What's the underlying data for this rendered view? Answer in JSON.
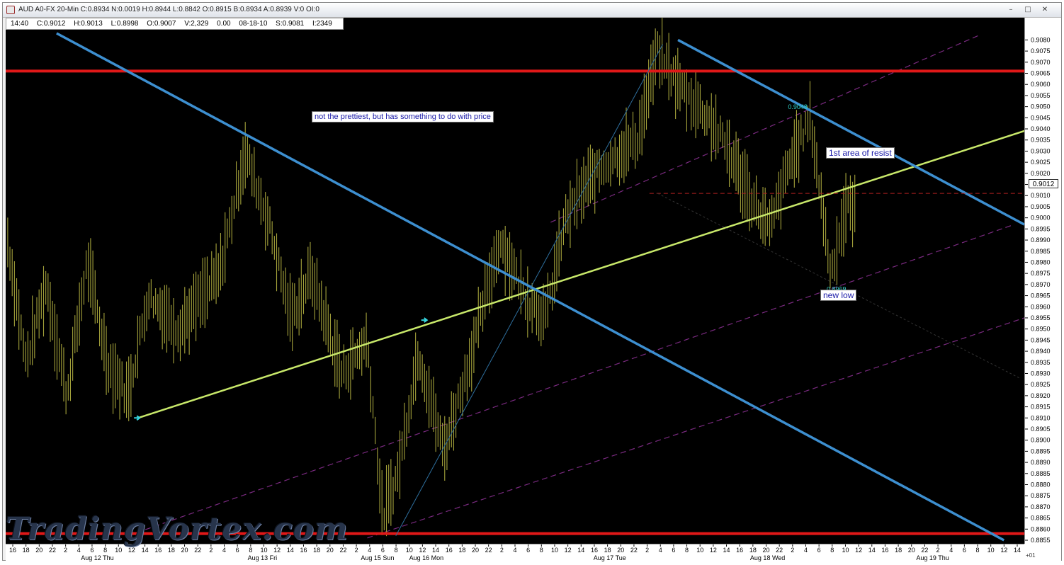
{
  "window": {
    "title": "AUD A0-FX 20-Min C:0.8934 N:0.0019 H:0.8944 L:0.8842 O:0.8915 B:0.8934 A:0.8939 V:0 OI:0",
    "buttons": {
      "minimize": "–",
      "maximize": "□",
      "close": "✕"
    }
  },
  "info_bar": [
    "14:40",
    "C:0.9012",
    "H:0.9013",
    "L:0.8998",
    "O:0.9007",
    "V:2,329",
    "0.00",
    "08-18-10",
    "S:0.9081",
    "I:2349"
  ],
  "annotations": {
    "note_price": "not the prettiest, but has something to do with price",
    "resist": "1st area of resist",
    "new_low": "new low",
    "label_high": "0.9048",
    "label_low": "0.8969"
  },
  "current_price_label": "0.9012",
  "watermark": "TradingVortex.com",
  "axis_corner_label": "+01",
  "chart_data": {
    "type": "bar",
    "instrument": "AUD A0-FX",
    "timeframe": "20-Min",
    "ylim": [
      0.8855,
      0.9083
    ],
    "y_ticks": [
      "0.9080",
      "0.9075",
      "0.9070",
      "0.9065",
      "0.9060",
      "0.9055",
      "0.9050",
      "0.9045",
      "0.9040",
      "0.9035",
      "0.9030",
      "0.9025",
      "0.9020",
      "0.9015",
      "0.9010",
      "0.9005",
      "0.9000",
      "0.8995",
      "0.8990",
      "0.8985",
      "0.8980",
      "0.8975",
      "0.8970",
      "0.8965",
      "0.8960",
      "0.8955",
      "0.8950",
      "0.8945",
      "0.8940",
      "0.8935",
      "0.8930",
      "0.8925",
      "0.8920",
      "0.8915",
      "0.8910",
      "0.8905",
      "0.8900",
      "0.8895",
      "0.8890",
      "0.8885",
      "0.8880",
      "0.8875",
      "0.8870",
      "0.8865",
      "0.8860",
      "0.8855"
    ],
    "x_hours": [
      "16",
      "18",
      "20",
      "22",
      "2",
      "4",
      "6",
      "8",
      "10",
      "12",
      "14",
      "16",
      "18",
      "20",
      "22",
      "2",
      "4",
      "6",
      "8",
      "10",
      "12",
      "14",
      "16",
      "18",
      "20",
      "22",
      "2",
      "4",
      "6",
      "8",
      "10",
      "12",
      "14",
      "16",
      "18",
      "20",
      "22",
      "2",
      "4",
      "6",
      "8",
      "10",
      "12",
      "14",
      "16",
      "18",
      "20",
      "22",
      "2",
      "4",
      "6",
      "8",
      "10",
      "12",
      "14",
      "16",
      "18",
      "20",
      "22",
      "2",
      "4",
      "6",
      "8",
      "10",
      "12",
      "14",
      "16",
      "18",
      "20",
      "22",
      "2",
      "4",
      "6",
      "8",
      "10",
      "12",
      "14"
    ],
    "x_days": [
      "Aug 12 Thu",
      "Aug 13 Fri",
      "Aug 15 Sun",
      "Aug 16 Mon",
      "Aug 17 Tue",
      "Aug 18 Wed",
      "Aug 19 Thu"
    ],
    "price_path": [
      {
        "t": 0.0,
        "p": 0.8995
      },
      {
        "t": 0.02,
        "p": 0.8935
      },
      {
        "t": 0.04,
        "p": 0.897
      },
      {
        "t": 0.06,
        "p": 0.892
      },
      {
        "t": 0.08,
        "p": 0.898
      },
      {
        "t": 0.1,
        "p": 0.8935
      },
      {
        "t": 0.12,
        "p": 0.892
      },
      {
        "t": 0.14,
        "p": 0.8965
      },
      {
        "t": 0.17,
        "p": 0.895
      },
      {
        "t": 0.21,
        "p": 0.8975
      },
      {
        "t": 0.235,
        "p": 0.903
      },
      {
        "t": 0.26,
        "p": 0.8995
      },
      {
        "t": 0.28,
        "p": 0.8955
      },
      {
        "t": 0.3,
        "p": 0.8975
      },
      {
        "t": 0.33,
        "p": 0.893
      },
      {
        "t": 0.355,
        "p": 0.8945
      },
      {
        "t": 0.37,
        "p": 0.8865
      },
      {
        "t": 0.385,
        "p": 0.8885
      },
      {
        "t": 0.405,
        "p": 0.894
      },
      {
        "t": 0.43,
        "p": 0.8895
      },
      {
        "t": 0.455,
        "p": 0.8935
      },
      {
        "t": 0.485,
        "p": 0.899
      },
      {
        "t": 0.51,
        "p": 0.8965
      },
      {
        "t": 0.53,
        "p": 0.8955
      },
      {
        "t": 0.55,
        "p": 0.9
      },
      {
        "t": 0.57,
        "p": 0.9015
      },
      {
        "t": 0.59,
        "p": 0.9025
      },
      {
        "t": 0.62,
        "p": 0.9035
      },
      {
        "t": 0.64,
        "p": 0.9075
      },
      {
        "t": 0.66,
        "p": 0.906
      },
      {
        "t": 0.69,
        "p": 0.9045
      },
      {
        "t": 0.71,
        "p": 0.903
      },
      {
        "t": 0.73,
        "p": 0.901
      },
      {
        "t": 0.75,
        "p": 0.8995
      },
      {
        "t": 0.77,
        "p": 0.9025
      },
      {
        "t": 0.79,
        "p": 0.9045
      },
      {
        "t": 0.8,
        "p": 0.901
      },
      {
        "t": 0.81,
        "p": 0.8975
      },
      {
        "t": 0.825,
        "p": 0.9005
      },
      {
        "t": 0.835,
        "p": 0.9005
      }
    ],
    "lines": [
      {
        "name": "resistance-horizontal",
        "color": "#e01818",
        "y": 0.9066
      },
      {
        "name": "support-horizontal",
        "color": "#e01818",
        "y": 0.8858
      },
      {
        "name": "uptrend",
        "color": "#c8e86a",
        "from": [
          0.13,
          0.891
        ],
        "to": [
          1.04,
          0.9045
        ]
      },
      {
        "name": "downtrend-long",
        "color": "#3d8fd0",
        "from": [
          0.05,
          0.9083
        ],
        "to": [
          0.98,
          0.8855
        ]
      },
      {
        "name": "downtrend-short",
        "color": "#3d8fd0",
        "from": [
          0.66,
          0.908
        ],
        "to": [
          1.0,
          0.8997
        ]
      }
    ]
  },
  "colors": {
    "background": "#000000",
    "bars": "#a5a33b",
    "resistance": "#e01818",
    "trend_up": "#c8e86a",
    "trend_down": "#3d8fd0",
    "channel": "#7a2a80",
    "note_text": "#1a1aa8"
  }
}
